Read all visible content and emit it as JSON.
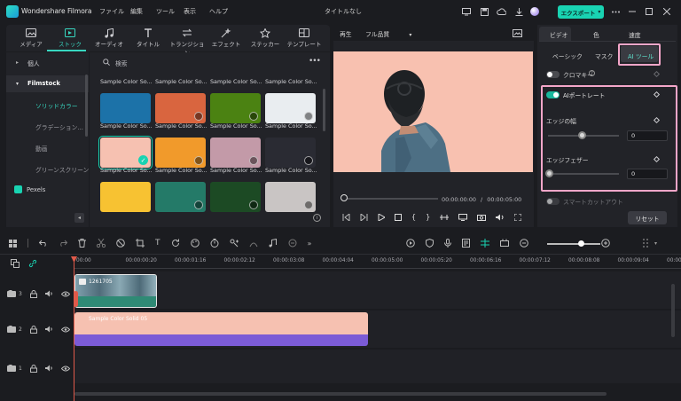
{
  "app": {
    "name": "Wondershare Filmora",
    "doc_title": "タイトルなし",
    "export_label": "エクスポート"
  },
  "menu": [
    "ファイル",
    "編集",
    "ツール",
    "表示",
    "ヘルプ"
  ],
  "media_tools": [
    {
      "label": "メディア",
      "icon": "media-icon"
    },
    {
      "label": "ストック",
      "icon": "stock-icon",
      "active": true
    },
    {
      "label": "オーディオ",
      "icon": "music-icon"
    },
    {
      "label": "タイトル",
      "icon": "title-icon"
    },
    {
      "label": "トランジション",
      "icon": "transition-icon"
    },
    {
      "label": "エフェクト",
      "icon": "effect-icon"
    },
    {
      "label": "ステッカー",
      "icon": "sticker-icon"
    },
    {
      "label": "テンプレート",
      "icon": "template-icon"
    }
  ],
  "sidebar": {
    "items": [
      "個人",
      "Filmstock",
      "ソリッドカラー",
      "グラデーション...",
      "動画",
      "グリーンスクリーン",
      "Pexels"
    ]
  },
  "library": {
    "search_placeholder": "検索",
    "cards": [
      {
        "label": "Sample Color So...",
        "color": "#1c72a8",
        "badge": false,
        "selected": false
      },
      {
        "label": "Sample Color So...",
        "color": "#d9653f",
        "badge": true,
        "selected": false
      },
      {
        "label": "Sample Color So...",
        "color": "#4b8212",
        "badge": true,
        "selected": false
      },
      {
        "label": "Sample Color So...",
        "color": "#e9edf0",
        "badge": true,
        "selected": false
      },
      {
        "label": "Sample Color So...",
        "color": "#f6c1b1",
        "badge": false,
        "selected": true
      },
      {
        "label": "Sample Color So...",
        "color": "#f19a2b",
        "badge": true,
        "selected": false
      },
      {
        "label": "Sample Color So...",
        "color": "#c39aa8",
        "badge": true,
        "selected": false
      },
      {
        "label": "Sample Color So...",
        "color": "#2a2b33",
        "badge": true,
        "selected": false
      },
      {
        "label": "Sample Color So...",
        "color": "#f7c232",
        "badge": false,
        "selected": false
      },
      {
        "label": "Sample Color So...",
        "color": "#247a68",
        "badge": true,
        "selected": false
      },
      {
        "label": "Sample Color So...",
        "color": "#1c4a24",
        "badge": true,
        "selected": false
      },
      {
        "label": "Sample Color So...",
        "color": "#c9c5c4",
        "badge": true,
        "selected": false
      }
    ]
  },
  "preview": {
    "play_label": "再生",
    "quality_label": "フル品質",
    "time_current": "00:00:00:00",
    "time_total": "00:00:05:00",
    "separator": "/"
  },
  "right_panel": {
    "tabs": [
      "ビデオ",
      "色",
      "速度"
    ],
    "subtabs": [
      "ベーシック",
      "マスク",
      "AI ツール"
    ],
    "chroma_label": "クロマキー",
    "ai_portrait_label": "AIポートレート",
    "edge_width_label": "エッジの幅",
    "edge_width_value": "0",
    "edge_feather_label": "エッジフェザー",
    "edge_feather_value": "0",
    "smart_cutout_label": "スマートカットアウト",
    "reset_label": "リセット",
    "colors": {
      "accent": "#19d3b2",
      "highlight": "#f4a6c9"
    }
  },
  "timeline": {
    "ruler": [
      "00:00",
      "00:00:00:20",
      "00:00:01:16",
      "00:00:02:12",
      "00:00:03:08",
      "00:00:04:04",
      "00:00:05:00",
      "00:00:05:20",
      "00:00:06:16",
      "00:00:07:12",
      "00:00:08:08",
      "00:00:09:04",
      "00:00:10:00"
    ],
    "tracks": [
      {
        "number": "3",
        "clip_label": "1261705"
      },
      {
        "number": "2",
        "clip_label": "Sample Color Solid 05"
      },
      {
        "number": "1",
        "clip_label": ""
      }
    ]
  }
}
